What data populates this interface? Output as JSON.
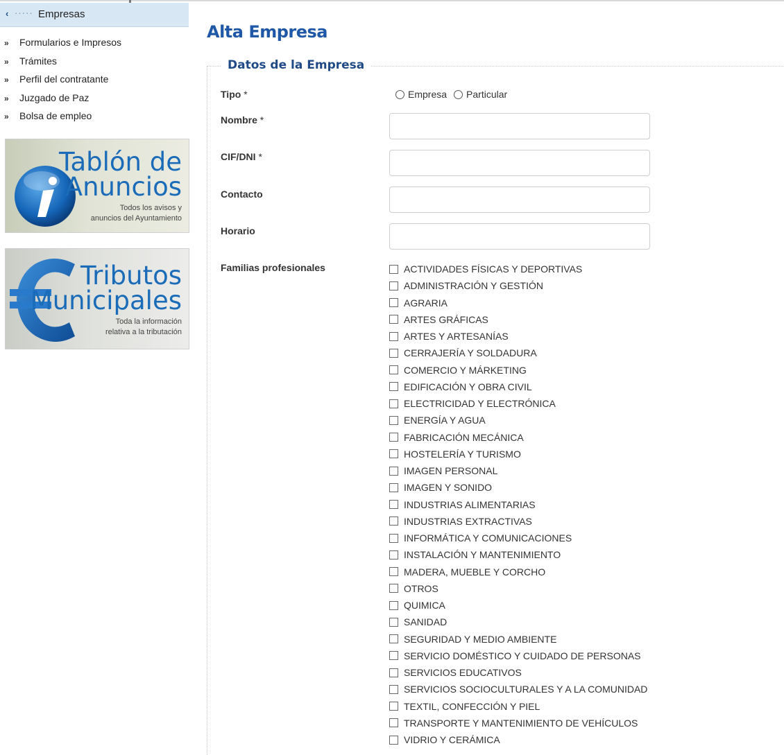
{
  "sidebar": {
    "header_label": "Empresas",
    "nav": [
      {
        "label": "Formularios e Impresos"
      },
      {
        "label": "Trámites"
      },
      {
        "label": "Perfil del contratante"
      },
      {
        "label": "Juzgado de Paz"
      },
      {
        "label": "Bolsa de empleo"
      }
    ],
    "banners": {
      "tablon": {
        "title1": "Tablón de",
        "title2": "Anuncios",
        "sub1": "Todos los avisos y",
        "sub2": "anuncios del Ayuntamiento",
        "icon": "info-icon"
      },
      "tributos": {
        "title1": "Tributos",
        "title2": "Municipales",
        "sub1": "Toda la información",
        "sub2": "relativa a la tributación",
        "icon": "euro-icon"
      }
    }
  },
  "main": {
    "title": "Alta Empresa",
    "legend": "Datos de la Empresa",
    "fields": {
      "tipo": {
        "label": "Tipo",
        "required": "*",
        "options": [
          "Empresa",
          "Particular"
        ]
      },
      "nombre": {
        "label": "Nombre",
        "required": "*",
        "value": ""
      },
      "cif": {
        "label": "CIF/DNI",
        "required": "*",
        "value": ""
      },
      "contacto": {
        "label": "Contacto",
        "value": ""
      },
      "horario": {
        "label": "Horario",
        "value": ""
      },
      "familias": {
        "label": "Familias profesionales",
        "options": [
          "ACTIVIDADES FÍSICAS Y DEPORTIVAS",
          "ADMINISTRACIÓN Y GESTIÓN",
          "AGRARIA",
          "ARTES GRÁFICAS",
          "ARTES Y ARTESANÍAS",
          "CERRAJERÍA Y SOLDADURA",
          "COMERCIO Y MÁRKETING",
          "EDIFICACIÓN Y OBRA CIVIL",
          "ELECTRICIDAD Y ELECTRÓNICA",
          "ENERGÍA Y AGUA",
          "FABRICACIÓN MECÁNICA",
          "HOSTELERÍA Y TURISMO",
          "IMAGEN PERSONAL",
          "IMAGEN Y SONIDO",
          "INDUSTRIAS ALIMENTARIAS",
          "INDUSTRIAS EXTRACTIVAS",
          "INFORMÁTICA Y COMUNICACIONES",
          "INSTALACIÓN Y MANTENIMIENTO",
          "MADERA, MUEBLE Y CORCHO",
          "OTROS",
          "QUIMICA",
          "SANIDAD",
          "SEGURIDAD Y MEDIO AMBIENTE",
          "SERVICIO DOMÉSTICO Y CUIDADO DE PERSONAS",
          "SERVICIOS EDUCATIVOS",
          "SERVICIOS SOCIOCULTURALES Y A LA COMUNIDAD",
          "TEXTIL, CONFECCIÓN Y PIEL",
          "TRANSPORTE Y MANTENIMIENTO DE VEHÍCULOS",
          "VIDRIO Y CERÁMICA"
        ]
      }
    }
  },
  "colors": {
    "accent": "#1f58a6",
    "sidebar_header_bg": "#d7e7f4",
    "banner_text": "#1a6bb8"
  }
}
